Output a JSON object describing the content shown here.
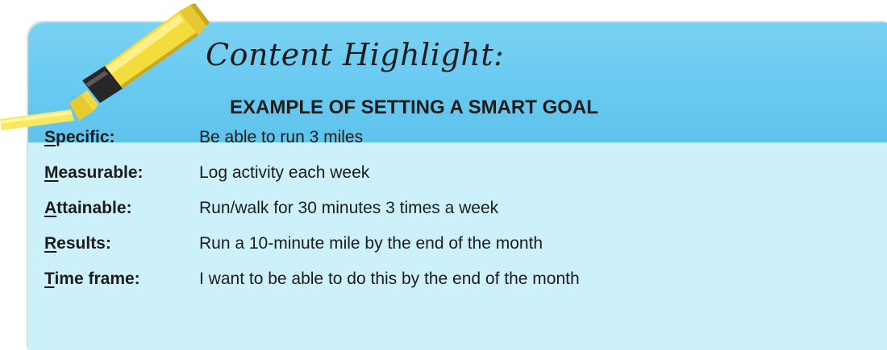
{
  "header": {
    "title": "Content Highlight:",
    "subtitle": "EXAMPLE OF SETTING A SMART GOAL"
  },
  "colors": {
    "header_background": "#6bcbf1",
    "body_background": "#cdf1fb",
    "highlighter_yellow": "#f6e24a",
    "text": "#1c1c1c"
  },
  "icons": {
    "highlighter": "yellow-highlighter-marker-icon"
  },
  "goal_rows": [
    {
      "initial": "S",
      "rest": "pecific:",
      "description": "Be able to run 3 miles"
    },
    {
      "initial": "M",
      "rest": "easurable:",
      "description": "Log activity each week"
    },
    {
      "initial": "A",
      "rest": "ttainable:",
      "description": "Run/walk for 30 minutes 3 times a week"
    },
    {
      "initial": "R",
      "rest": "esults:",
      "description": "Run a 10-minute mile by the end of the month"
    },
    {
      "initial": "T",
      "rest": "ime frame:",
      "description": "I want to be able to do this by the end of the month"
    }
  ]
}
